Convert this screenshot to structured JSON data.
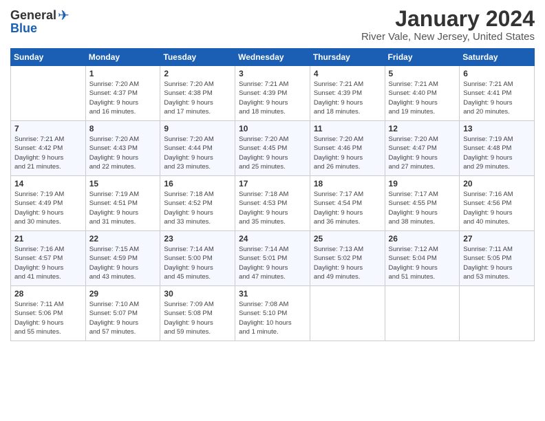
{
  "logo": {
    "general": "General",
    "blue": "Blue"
  },
  "header": {
    "title": "January 2024",
    "subtitle": "River Vale, New Jersey, United States"
  },
  "weekdays": [
    "Sunday",
    "Monday",
    "Tuesday",
    "Wednesday",
    "Thursday",
    "Friday",
    "Saturday"
  ],
  "weeks": [
    [
      {
        "day": "",
        "info": ""
      },
      {
        "day": "1",
        "info": "Sunrise: 7:20 AM\nSunset: 4:37 PM\nDaylight: 9 hours\nand 16 minutes."
      },
      {
        "day": "2",
        "info": "Sunrise: 7:20 AM\nSunset: 4:38 PM\nDaylight: 9 hours\nand 17 minutes."
      },
      {
        "day": "3",
        "info": "Sunrise: 7:21 AM\nSunset: 4:39 PM\nDaylight: 9 hours\nand 18 minutes."
      },
      {
        "day": "4",
        "info": "Sunrise: 7:21 AM\nSunset: 4:39 PM\nDaylight: 9 hours\nand 18 minutes."
      },
      {
        "day": "5",
        "info": "Sunrise: 7:21 AM\nSunset: 4:40 PM\nDaylight: 9 hours\nand 19 minutes."
      },
      {
        "day": "6",
        "info": "Sunrise: 7:21 AM\nSunset: 4:41 PM\nDaylight: 9 hours\nand 20 minutes."
      }
    ],
    [
      {
        "day": "7",
        "info": "Sunrise: 7:21 AM\nSunset: 4:42 PM\nDaylight: 9 hours\nand 21 minutes."
      },
      {
        "day": "8",
        "info": "Sunrise: 7:20 AM\nSunset: 4:43 PM\nDaylight: 9 hours\nand 22 minutes."
      },
      {
        "day": "9",
        "info": "Sunrise: 7:20 AM\nSunset: 4:44 PM\nDaylight: 9 hours\nand 23 minutes."
      },
      {
        "day": "10",
        "info": "Sunrise: 7:20 AM\nSunset: 4:45 PM\nDaylight: 9 hours\nand 25 minutes."
      },
      {
        "day": "11",
        "info": "Sunrise: 7:20 AM\nSunset: 4:46 PM\nDaylight: 9 hours\nand 26 minutes."
      },
      {
        "day": "12",
        "info": "Sunrise: 7:20 AM\nSunset: 4:47 PM\nDaylight: 9 hours\nand 27 minutes."
      },
      {
        "day": "13",
        "info": "Sunrise: 7:19 AM\nSunset: 4:48 PM\nDaylight: 9 hours\nand 29 minutes."
      }
    ],
    [
      {
        "day": "14",
        "info": "Sunrise: 7:19 AM\nSunset: 4:49 PM\nDaylight: 9 hours\nand 30 minutes."
      },
      {
        "day": "15",
        "info": "Sunrise: 7:19 AM\nSunset: 4:51 PM\nDaylight: 9 hours\nand 31 minutes."
      },
      {
        "day": "16",
        "info": "Sunrise: 7:18 AM\nSunset: 4:52 PM\nDaylight: 9 hours\nand 33 minutes."
      },
      {
        "day": "17",
        "info": "Sunrise: 7:18 AM\nSunset: 4:53 PM\nDaylight: 9 hours\nand 35 minutes."
      },
      {
        "day": "18",
        "info": "Sunrise: 7:17 AM\nSunset: 4:54 PM\nDaylight: 9 hours\nand 36 minutes."
      },
      {
        "day": "19",
        "info": "Sunrise: 7:17 AM\nSunset: 4:55 PM\nDaylight: 9 hours\nand 38 minutes."
      },
      {
        "day": "20",
        "info": "Sunrise: 7:16 AM\nSunset: 4:56 PM\nDaylight: 9 hours\nand 40 minutes."
      }
    ],
    [
      {
        "day": "21",
        "info": "Sunrise: 7:16 AM\nSunset: 4:57 PM\nDaylight: 9 hours\nand 41 minutes."
      },
      {
        "day": "22",
        "info": "Sunrise: 7:15 AM\nSunset: 4:59 PM\nDaylight: 9 hours\nand 43 minutes."
      },
      {
        "day": "23",
        "info": "Sunrise: 7:14 AM\nSunset: 5:00 PM\nDaylight: 9 hours\nand 45 minutes."
      },
      {
        "day": "24",
        "info": "Sunrise: 7:14 AM\nSunset: 5:01 PM\nDaylight: 9 hours\nand 47 minutes."
      },
      {
        "day": "25",
        "info": "Sunrise: 7:13 AM\nSunset: 5:02 PM\nDaylight: 9 hours\nand 49 minutes."
      },
      {
        "day": "26",
        "info": "Sunrise: 7:12 AM\nSunset: 5:04 PM\nDaylight: 9 hours\nand 51 minutes."
      },
      {
        "day": "27",
        "info": "Sunrise: 7:11 AM\nSunset: 5:05 PM\nDaylight: 9 hours\nand 53 minutes."
      }
    ],
    [
      {
        "day": "28",
        "info": "Sunrise: 7:11 AM\nSunset: 5:06 PM\nDaylight: 9 hours\nand 55 minutes."
      },
      {
        "day": "29",
        "info": "Sunrise: 7:10 AM\nSunset: 5:07 PM\nDaylight: 9 hours\nand 57 minutes."
      },
      {
        "day": "30",
        "info": "Sunrise: 7:09 AM\nSunset: 5:08 PM\nDaylight: 9 hours\nand 59 minutes."
      },
      {
        "day": "31",
        "info": "Sunrise: 7:08 AM\nSunset: 5:10 PM\nDaylight: 10 hours\nand 1 minute."
      },
      {
        "day": "",
        "info": ""
      },
      {
        "day": "",
        "info": ""
      },
      {
        "day": "",
        "info": ""
      }
    ]
  ]
}
